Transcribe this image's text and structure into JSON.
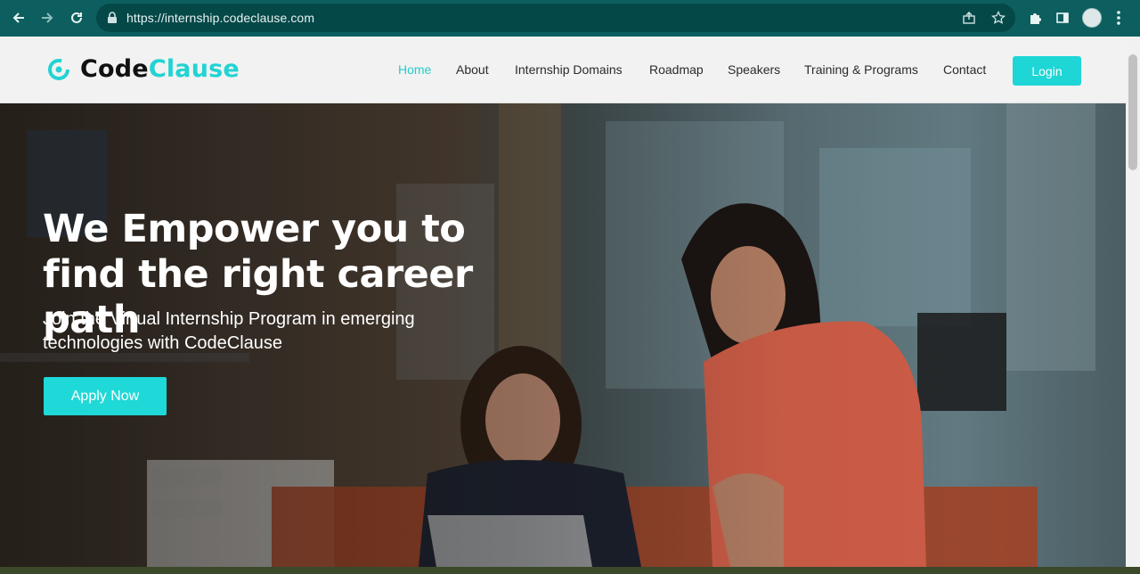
{
  "browser": {
    "url": "https://internship.codeclause.com",
    "icons": [
      "back-arrow-icon",
      "forward-arrow-icon",
      "reload-icon",
      "lock-icon",
      "share-icon",
      "star-icon",
      "puzzle-extension-icon",
      "side-panel-icon",
      "profile-avatar",
      "kebab-menu-icon"
    ],
    "chrome_color": "#0d5f5f"
  },
  "header": {
    "logo_part1": "Code",
    "logo_part2": "Clause",
    "nav": [
      {
        "label": "Home",
        "active": true
      },
      {
        "label": "About"
      },
      {
        "label": "Internship Domains"
      },
      {
        "label": "Roadmap"
      },
      {
        "label": "Speakers"
      },
      {
        "label": "Training & Programs"
      },
      {
        "label": "Contact"
      }
    ],
    "login_label": "Login",
    "accent_color": "#1ed6d6"
  },
  "hero": {
    "title": "We Empower you to find the right career path",
    "subtitle": "Join the Virtual Internship Program in emerging technologies with CodeClause",
    "cta_label": "Apply Now"
  }
}
